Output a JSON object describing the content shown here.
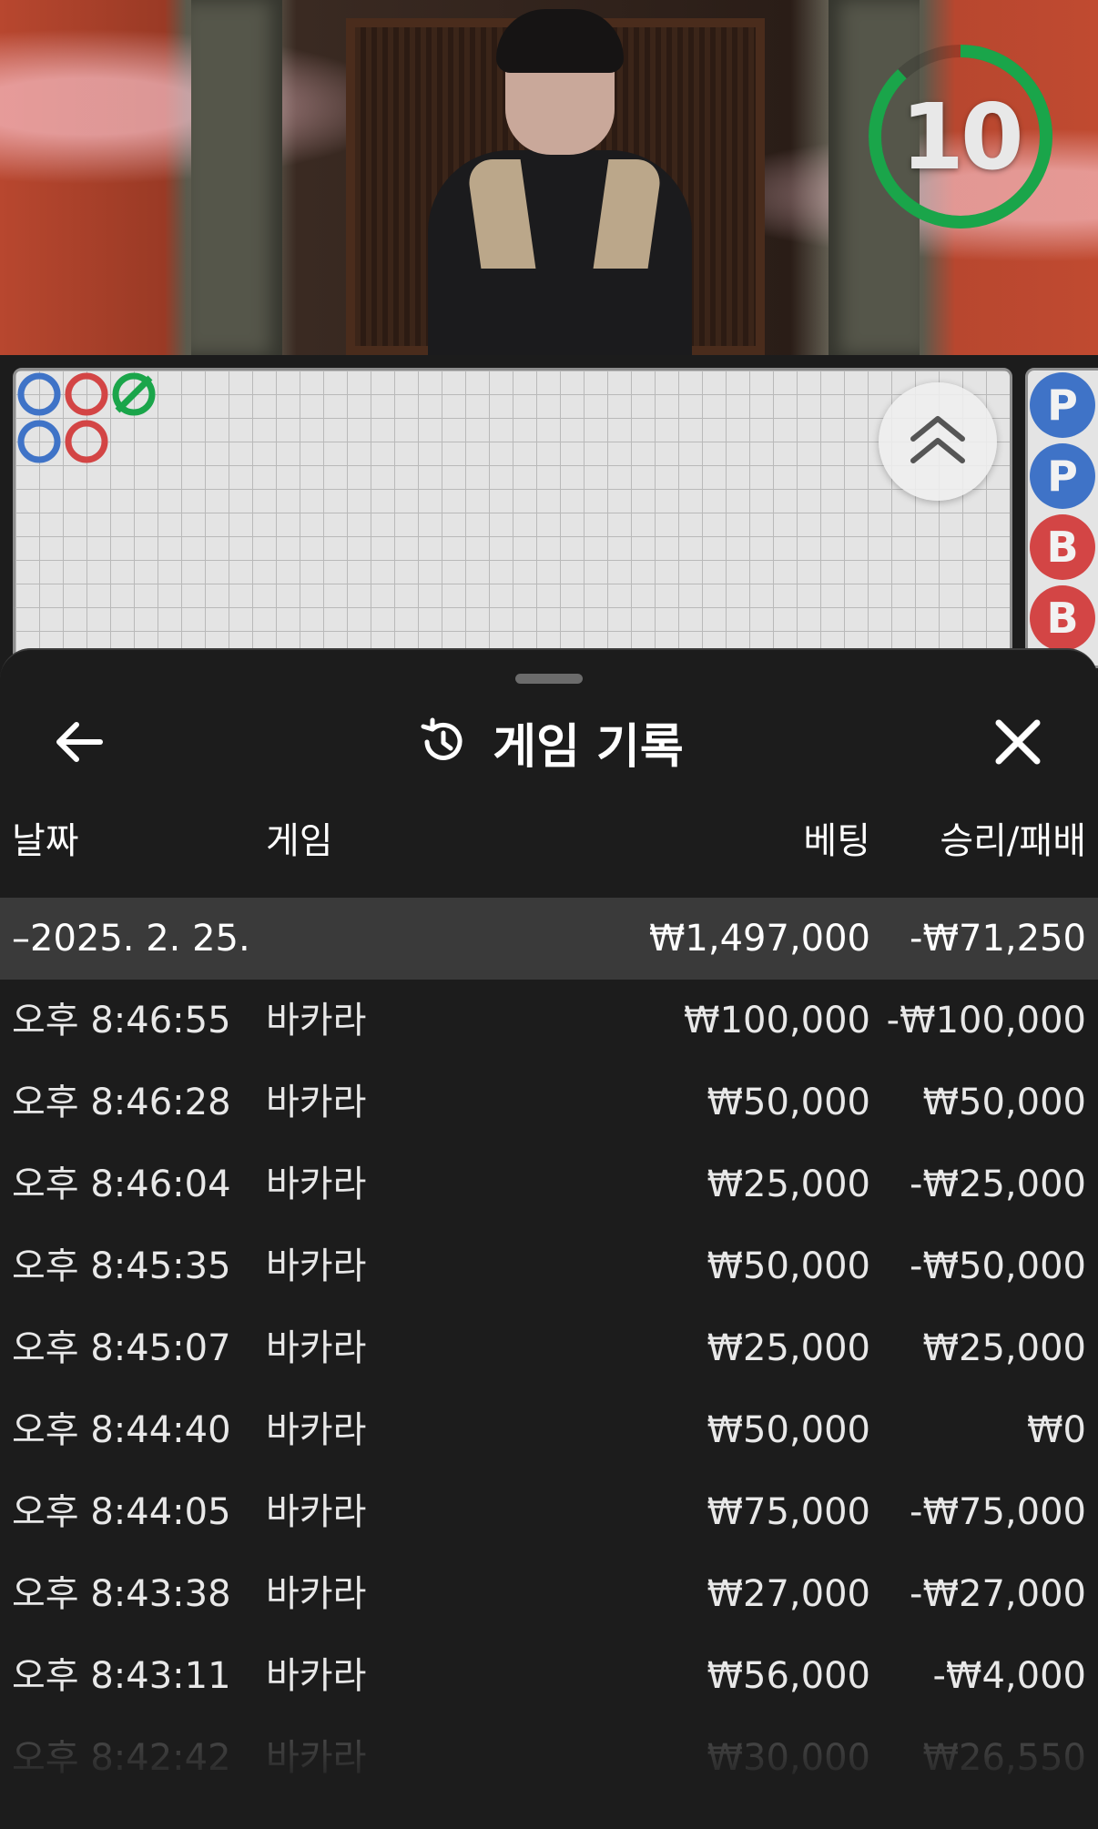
{
  "timer": {
    "value": "10",
    "color": "#1aa54a"
  },
  "roadmap": {
    "big_road": [
      {
        "col": 0,
        "row": 0,
        "color": "#3f73c7"
      },
      {
        "col": 1,
        "row": 0,
        "color": "#d34545"
      },
      {
        "col": 2,
        "row": 0,
        "color": "#1aa54a"
      },
      {
        "col": 0,
        "row": 1,
        "color": "#3f73c7"
      },
      {
        "col": 1,
        "row": 1,
        "color": "#d34545"
      }
    ],
    "bead_road": [
      {
        "label": "P",
        "type": "p"
      },
      {
        "label": "P",
        "type": "p"
      },
      {
        "label": "B",
        "type": "b"
      },
      {
        "label": "B",
        "type": "b"
      }
    ]
  },
  "sheet": {
    "title": "게임 기록",
    "columns": {
      "date": "날짜",
      "game": "게임",
      "bet": "베팅",
      "win_loss": "승리/패배"
    },
    "group": {
      "date": "–2025. 2. 25.",
      "bet": "₩1,497,000",
      "win_loss": "-₩71,250"
    },
    "rows": [
      {
        "time": "오후 8:46:55",
        "game": "바카라",
        "bet": "₩100,000",
        "win_loss": "-₩100,000"
      },
      {
        "time": "오후 8:46:28",
        "game": "바카라",
        "bet": "₩50,000",
        "win_loss": "₩50,000"
      },
      {
        "time": "오후 8:46:04",
        "game": "바카라",
        "bet": "₩25,000",
        "win_loss": "-₩25,000"
      },
      {
        "time": "오후 8:45:35",
        "game": "바카라",
        "bet": "₩50,000",
        "win_loss": "-₩50,000"
      },
      {
        "time": "오후 8:45:07",
        "game": "바카라",
        "bet": "₩25,000",
        "win_loss": "₩25,000"
      },
      {
        "time": "오후 8:44:40",
        "game": "바카라",
        "bet": "₩50,000",
        "win_loss": "₩0"
      },
      {
        "time": "오후 8:44:05",
        "game": "바카라",
        "bet": "₩75,000",
        "win_loss": "-₩75,000"
      },
      {
        "time": "오후 8:43:38",
        "game": "바카라",
        "bet": "₩27,000",
        "win_loss": "-₩27,000"
      },
      {
        "time": "오후 8:43:11",
        "game": "바카라",
        "bet": "₩56,000",
        "win_loss": "-₩4,000"
      },
      {
        "time": "오후 8:42:42",
        "game": "바카라",
        "bet": "₩30,000",
        "win_loss": "₩26,550"
      }
    ]
  },
  "icons": {
    "back": "arrow-left-icon",
    "close": "close-icon",
    "history": "history-icon",
    "scroll_up": "chevron-double-up-icon"
  }
}
